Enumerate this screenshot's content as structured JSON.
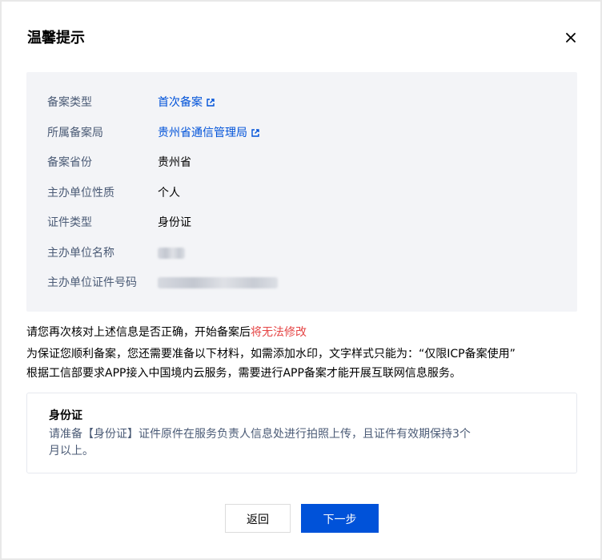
{
  "dialog": {
    "title": "温馨提示",
    "close_icon": "close-icon"
  },
  "info": {
    "rows": [
      {
        "label": "备案类型",
        "value": "首次备案",
        "link": true,
        "icon": "external-link-icon"
      },
      {
        "label": "所属备案局",
        "value": "贵州省通信管理局",
        "link": true,
        "icon": "external-link-icon"
      },
      {
        "label": "备案省份",
        "value": "贵州省"
      },
      {
        "label": "主办单位性质",
        "value": "个人"
      },
      {
        "label": "证件类型",
        "value": "身份证"
      },
      {
        "label": "主办单位名称",
        "value": ""
      },
      {
        "label": "主办单位证件号码",
        "value": ""
      }
    ]
  },
  "notices": {
    "line1_prefix": "请您再次核对上述信息是否正确，开始备案后",
    "line1_warn": "将无法修改",
    "line2": "为保证您顺利备案，您还需要准备以下材料，如需添加水印，文字样式只能为：“仅限ICP备案使用”",
    "line3": "根据工信部要求APP接入中国境内云服务，需要进行APP备案才能开展互联网信息服务。"
  },
  "document": {
    "title": "身份证",
    "description": "请准备【身份证】证件原件在服务负责人信息处进行拍照上传，且证件有效期保持3个月以上。"
  },
  "buttons": {
    "back_label": "返回",
    "next_label": "下一步"
  },
  "colors": {
    "primary": "#0052d9",
    "warning": "#e54545",
    "label": "#4b5b76",
    "panel_bg": "#f3f4f7"
  }
}
